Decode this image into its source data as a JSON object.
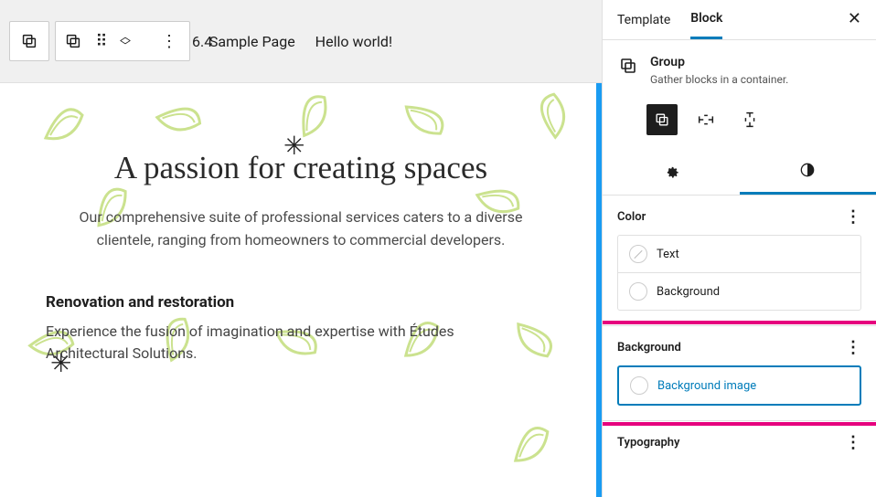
{
  "toolbar": {
    "version": "6.4"
  },
  "nav": {
    "item1": "Sample Page",
    "item2": "Hello world!"
  },
  "hero": {
    "heading": "A passion for creating spaces",
    "sub": "Our comprehensive suite of professional services caters to a diverse clientele, ranging from homeowners to commercial developers."
  },
  "section1": {
    "heading": "Renovation and restoration",
    "body": "Experience the fusion of imagination and expertise with Études Architectural Solutions."
  },
  "sidebar": {
    "tabs": {
      "template": "Template",
      "block": "Block"
    },
    "block": {
      "name": "Group",
      "desc": "Gather blocks in a container."
    },
    "panels": {
      "color": {
        "title": "Color",
        "text_label": "Text",
        "background_label": "Background"
      },
      "background": {
        "title": "Background",
        "image_label": "Background image"
      },
      "typography": {
        "title": "Typography"
      }
    }
  }
}
